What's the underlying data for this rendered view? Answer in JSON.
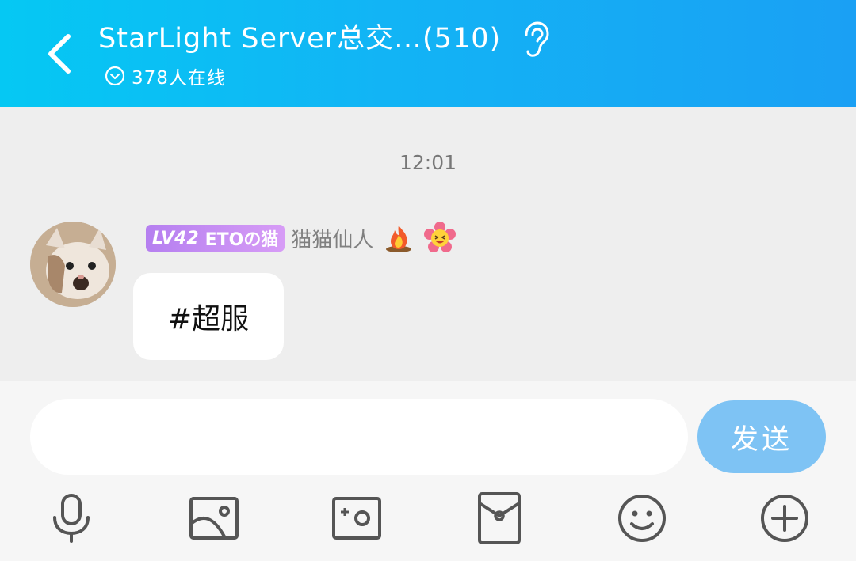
{
  "header": {
    "title": "StarLight Server总交…(510)",
    "online_count": "378人在线"
  },
  "chat": {
    "timestamp": "12:01",
    "message": {
      "level": "LV42",
      "title_badge": "ETOの猫",
      "nickname": "猫猫仙人",
      "emoji_icons": [
        "fire-icon",
        "flower-laughing-icon"
      ],
      "text": "#超服"
    }
  },
  "composer": {
    "placeholder": "",
    "send_label": "发送"
  },
  "toolbar": {
    "icons": [
      "microphone-icon",
      "image-icon",
      "camera-icon",
      "red-packet-icon",
      "emoji-icon",
      "plus-icon"
    ]
  },
  "colors": {
    "header_gradient_start": "#05c8f3",
    "header_gradient_end": "#1aa0f4",
    "send_button": "#7ec3f4",
    "badge": "#c48af3"
  }
}
